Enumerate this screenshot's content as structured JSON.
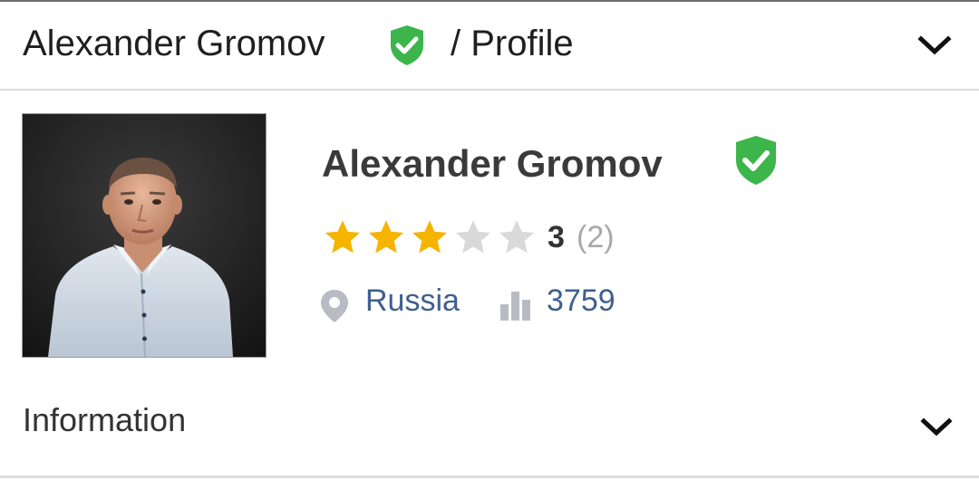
{
  "header": {
    "title": "Alexander Gromov",
    "crumb": "/ Profile",
    "verified": true,
    "toggle_icon": "chevron-down-icon"
  },
  "profile": {
    "name": "Alexander Gromov",
    "verified": true,
    "avatar": "profile-photo",
    "rating": {
      "value": "3",
      "count": "(2)",
      "stars_filled": 3,
      "stars_total": 5
    },
    "location": {
      "icon": "location-pin-icon",
      "text": "Russia"
    },
    "stats": {
      "icon": "bar-chart-icon",
      "value": "3759"
    }
  },
  "information": {
    "title": "Information",
    "toggle_icon": "chevron-down-icon"
  },
  "colors": {
    "verified_green": "#3cb54a",
    "star_filled": "#f5b400",
    "star_empty": "#d9d9d9",
    "link_blue": "#3f5f8f",
    "icon_gray": "#b8bcc2",
    "divider": "#dcdcdc"
  }
}
